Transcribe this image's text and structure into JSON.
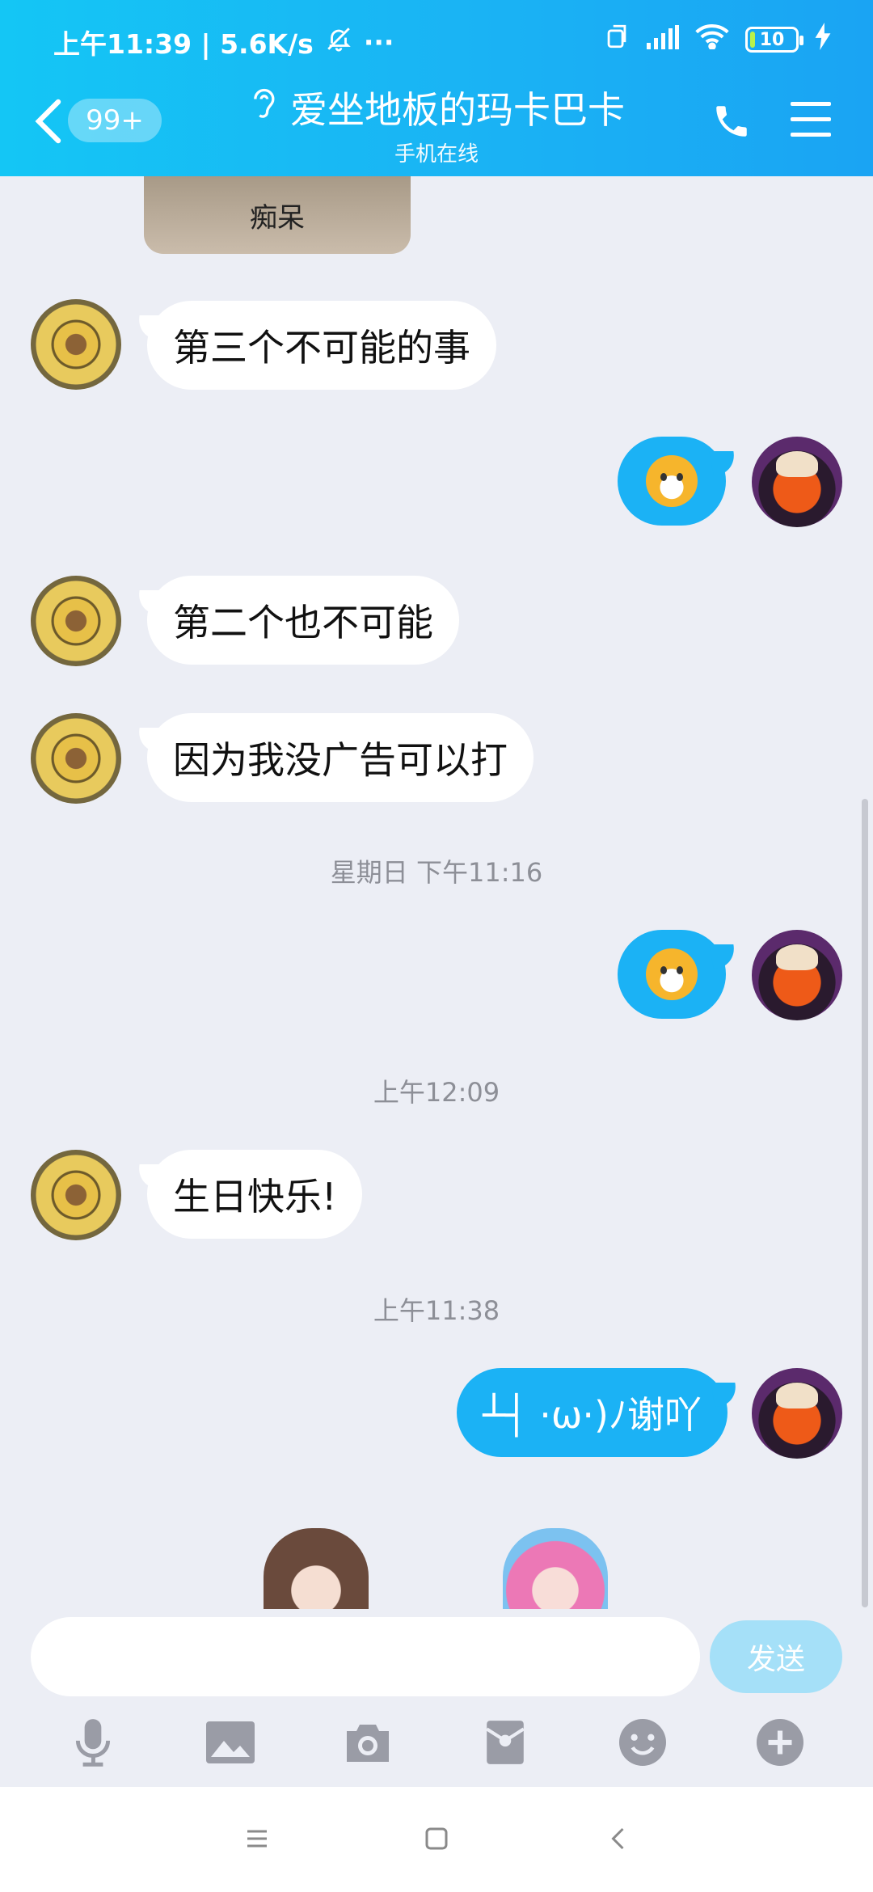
{
  "status_bar": {
    "time_speed": "上午11:39 | 5.6K/s",
    "more": "···",
    "battery": "10"
  },
  "header": {
    "unread_badge": "99+",
    "contact_name": "爱坐地板的玛卡巴卡",
    "contact_status": "手机在线"
  },
  "chat": {
    "photo_caption": "痴呆",
    "messages": [
      {
        "text": "第三个不可能的事"
      },
      {
        "text": "第二个也不可能"
      },
      {
        "text": "因为我没广告可以打"
      },
      {
        "text": "生日快乐!"
      },
      {
        "text": "┴┤ ·ω·)ﾉ谢吖"
      }
    ],
    "timestamps": [
      "星期日 下午11:16",
      "上午12:09",
      "上午11:38"
    ]
  },
  "input": {
    "placeholder": "",
    "send_label": "发送"
  },
  "colors": {
    "header": "#1ab3f4",
    "my_bubble": "#1bb2f5",
    "friend_bubble": "#ffffff",
    "background": "#eceef5"
  }
}
